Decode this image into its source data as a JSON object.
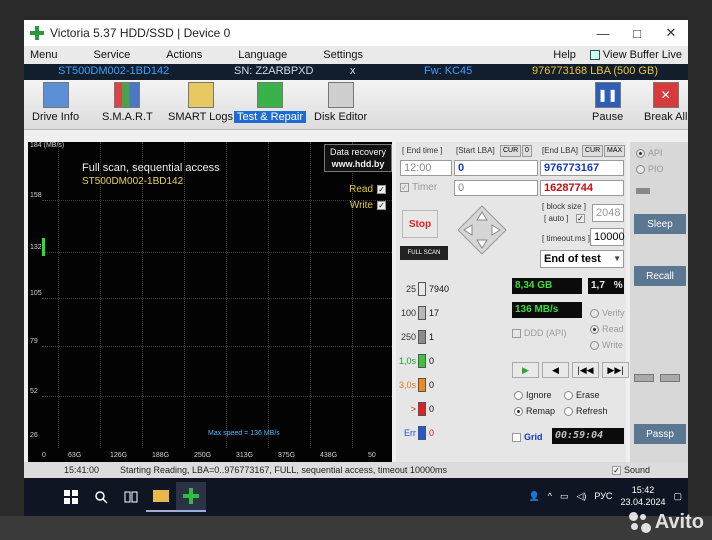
{
  "window": {
    "title": "Victoria 5.37 HDD/SSD | Device 0",
    "min_symbol": "—",
    "max_symbol": "□",
    "close_symbol": "✕"
  },
  "menu": {
    "items": [
      "Menu",
      "Service",
      "Actions",
      "Language",
      "Settings"
    ],
    "help": "Help",
    "view_buffer": "View Buffer Live"
  },
  "device": {
    "model": "ST500DM002-1BD142",
    "serial": "SN: Z2ARBPXD",
    "close": "x",
    "firmware": "Fw: KC45",
    "capacity": "976773168 LBA (500 GB)"
  },
  "toolbar": {
    "tabs": [
      {
        "label": "Drive Info",
        "icon": "info-icon"
      },
      {
        "label": "S.M.A.R.T",
        "icon": "smart-chart-icon"
      },
      {
        "label": "SMART Logs",
        "icon": "logs-folder-icon"
      },
      {
        "label": "Test & Repair",
        "icon": "test-repair-icon",
        "active": true
      },
      {
        "label": "Disk Editor",
        "icon": "disk-editor-icon"
      }
    ],
    "pause": "Pause",
    "break_all": "Break All"
  },
  "graph": {
    "y_unit": "184 (MB/s)",
    "y_ticks": [
      "158",
      "132",
      "105",
      "79",
      "52",
      "26"
    ],
    "x_ticks": [
      "0",
      "63G",
      "126G",
      "188G",
      "250G",
      "313G",
      "375G",
      "438G",
      "50"
    ],
    "title": "Full scan, sequential access",
    "model": "ST500DM002-1BD142",
    "recovery_line1": "Data recovery",
    "recovery_line2": "www.hdd.by",
    "read_label": "Read",
    "write_label": "Write",
    "max_speed": "Max speed = 136 MB/s"
  },
  "controls": {
    "end_time_label": "[ End time ]",
    "start_lba_label": "[Start LBA]",
    "cur_label": "CUR",
    "zero_label": "0",
    "end_lba_label": "[End LBA]",
    "cur2_label": "CUR",
    "max_label": "MAX",
    "end_time_value": "12:00",
    "start_lba_value": "0",
    "end_lba_value": "976773167",
    "timer_label": "Timer",
    "timer_value": "0",
    "remaining_value": "16287744",
    "stop": "Stop",
    "full_scan": "FULL SCAN",
    "block_size_label": "[ block size ]",
    "auto_label": "[ auto ]",
    "block_size_value": "2048",
    "timeout_label": "[ timeout.ms ]",
    "timeout_value": "10000",
    "end_action": "End of test"
  },
  "legend": [
    {
      "key": "25",
      "count": "7940",
      "color": "#e8e8e8"
    },
    {
      "key": "100",
      "count": "17",
      "color": "#b8b8b8"
    },
    {
      "key": "250",
      "count": "1",
      "color": "#8a8a8a"
    },
    {
      "key": "1,0s",
      "count": "0",
      "color": "#3cc43c"
    },
    {
      "key": "3,0s",
      "count": "0",
      "color": "#f08a1a"
    },
    {
      "key": ">",
      "count": "0",
      "color": "#e02020"
    },
    {
      "key": "Err",
      "count": "0",
      "color": "#2058d8"
    }
  ],
  "stats": {
    "gb": "8,34 GB",
    "percent": "1,7",
    "percent_sign": "%",
    "speed": "136 MB/s",
    "ddd_api": "DDD (API)",
    "verify": "Verify",
    "read": "Read",
    "write": "Write"
  },
  "actions": {
    "ignore": "Ignore",
    "erase": "Erase",
    "remap": "Remap",
    "refresh": "Refresh",
    "grid": "Grid",
    "elapsed": "00:59:04"
  },
  "right": {
    "api": "API",
    "pio": "PIO",
    "sleep": "Sleep",
    "recall": "Recall",
    "passp": "Passp",
    "sound": "Sound"
  },
  "status": {
    "time": "15:41:00",
    "message": "Starting Reading, LBA=0..976773167, FULL, sequential access, timeout 10000ms"
  },
  "taskbar": {
    "lang": "РУС",
    "time": "15:42",
    "date": "23.04.2024"
  },
  "watermark": "Avito",
  "colors": {
    "accent": "#1f6bd6",
    "graph_bg": "#030303",
    "status_blue": "#5c7792"
  }
}
